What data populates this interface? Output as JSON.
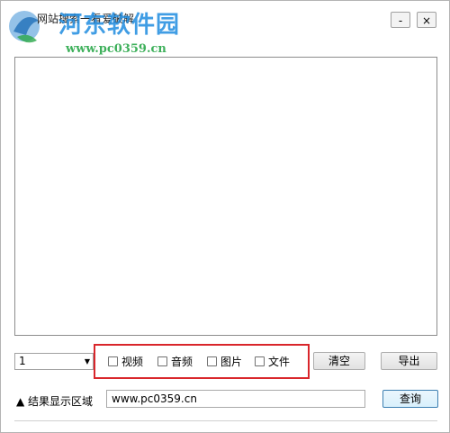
{
  "window": {
    "title": "网站搜索一看爱破解",
    "minimize_label": "-",
    "close_label": "×"
  },
  "watermark": {
    "name": "河东软件园",
    "url": "www.pc0359.cn"
  },
  "controls": {
    "page_select_value": "1",
    "checkboxes": [
      {
        "label": "视频",
        "checked": false
      },
      {
        "label": "音频",
        "checked": false
      },
      {
        "label": "图片",
        "checked": false
      },
      {
        "label": "文件",
        "checked": false
      }
    ],
    "clear_label": "清空",
    "export_label": "导出",
    "result_area_label": "▲ 结果显示区域",
    "url_value": "www.pc0359.cn",
    "query_label": "查询"
  },
  "colors": {
    "highlight": "#d9262b",
    "watermark_blue": "#1f8ce0",
    "watermark_green": "#2aa84a"
  }
}
